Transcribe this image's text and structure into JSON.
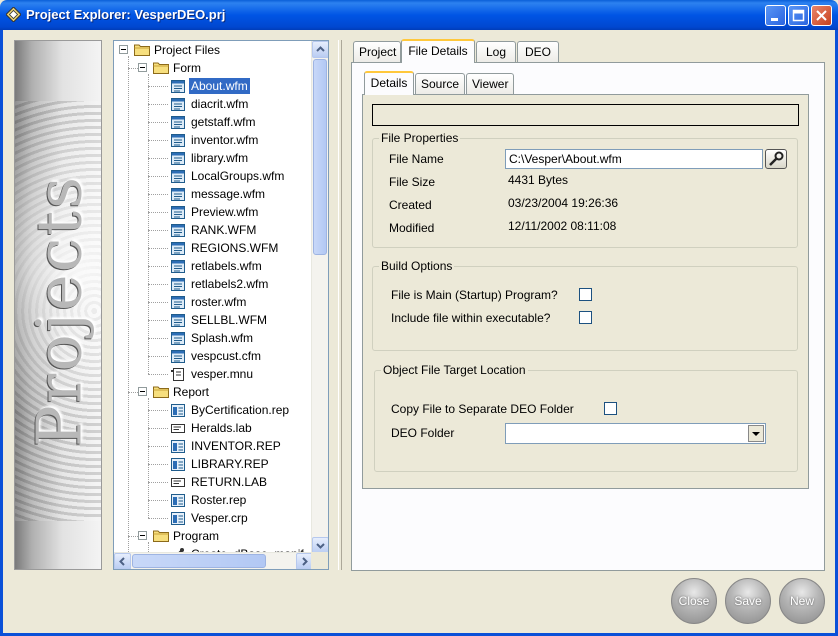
{
  "window": {
    "title": "Project Explorer: VesperDEO.prj"
  },
  "banner": {
    "text": "Projects"
  },
  "tree": {
    "root": "Project Files",
    "groups": [
      {
        "label": "Form",
        "files": [
          "About.wfm",
          "diacrit.wfm",
          "getstaff.wfm",
          "inventor.wfm",
          "library.wfm",
          "LocalGroups.wfm",
          "message.wfm",
          "Preview.wfm",
          "RANK.WFM",
          "REGIONS.WFM",
          "retlabels.wfm",
          "retlabels2.wfm",
          "roster.wfm",
          "SELLBL.WFM",
          "Splash.wfm",
          "vespcust.cfm",
          "vesper.mnu"
        ]
      },
      {
        "label": "Report",
        "files": [
          "ByCertification.rep",
          "Heralds.lab",
          "INVENTOR.REP",
          "LIBRARY.REP",
          "RETURN.LAB",
          "Roster.rep",
          "Vesper.crp"
        ]
      },
      {
        "label": "Program",
        "files": [
          "Create_dBase_manif"
        ]
      }
    ],
    "selected": "About.wfm"
  },
  "tabs": {
    "outer": [
      "Project",
      "File Details",
      "Log",
      "DEO"
    ],
    "inner": [
      "Details",
      "Source",
      "Viewer"
    ]
  },
  "file_properties": {
    "title": "File Properties",
    "name_label": "File Name",
    "name_value": "C:\\Vesper\\About.wfm",
    "size_label": "File Size",
    "size_value": "4431 Bytes",
    "created_label": "Created",
    "created_value": "03/23/2004 19:26:36",
    "modified_label": "Modified",
    "modified_value": "12/11/2002 08:11:08"
  },
  "build_options": {
    "title": "Build Options",
    "main_label": "File is Main (Startup) Program?",
    "include_label": "Include file within executable?"
  },
  "object_target": {
    "title": "Object File Target Location",
    "copy_label": "Copy File to Separate DEO Folder",
    "folder_label": "DEO Folder",
    "folder_value": ""
  },
  "buttons": {
    "close": "Close",
    "save": "Save",
    "new": "New"
  },
  "colors": {
    "titlebar": "#0055E5",
    "selection": "#316AC5",
    "active_tab_accent": "#FFC83C"
  }
}
